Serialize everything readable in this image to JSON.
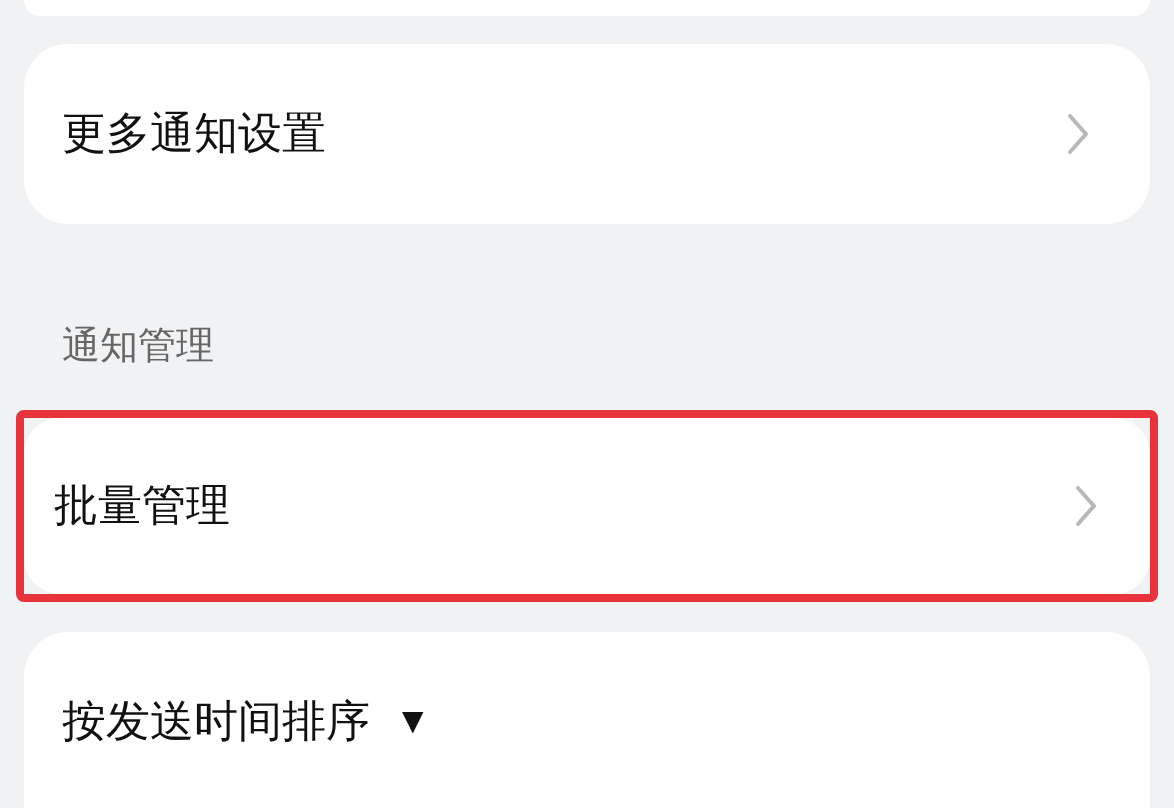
{
  "more_settings": {
    "label": "更多通知设置"
  },
  "section_title": "通知管理",
  "batch": {
    "label": "批量管理",
    "highlighted": true
  },
  "sort": {
    "label": "按发送时间排序",
    "caret": "▼"
  }
}
